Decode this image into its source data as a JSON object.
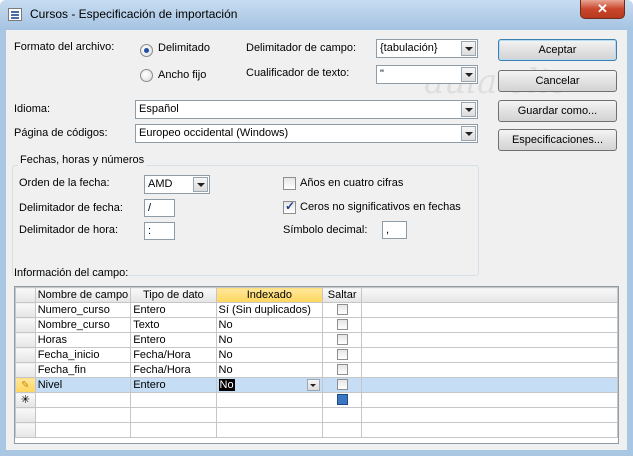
{
  "window": {
    "title": "Cursos - Especificación de importación",
    "close_glyph": "✕"
  },
  "format": {
    "label": "Formato del archivo:",
    "options": [
      {
        "label": "Delimitado",
        "selected": true
      },
      {
        "label": "Ancho fijo",
        "selected": false
      }
    ]
  },
  "delimiter": {
    "label": "Delimitador de campo:",
    "value": "{tabulación}"
  },
  "qualifier": {
    "label": "Cualificador de texto:",
    "value": "\""
  },
  "language": {
    "label": "Idioma:",
    "value": "Español"
  },
  "codepage": {
    "label": "Página de códigos:",
    "value": "Europeo occidental (Windows)"
  },
  "group": {
    "title": "Fechas, horas y números",
    "date_order": {
      "label": "Orden de la fecha:",
      "value": "AMD"
    },
    "date_delimiter": {
      "label": "Delimitador de fecha:",
      "value": "/"
    },
    "time_delimiter": {
      "label": "Delimitador de hora:",
      "value": ":"
    },
    "four_digit_years": {
      "label": "Años en cuatro cifras",
      "checked": false
    },
    "leading_zeros": {
      "label": "Ceros no significativos en fechas",
      "checked": true
    },
    "decimal_symbol": {
      "label": "Símbolo decimal:",
      "value": ","
    }
  },
  "buttons": {
    "accept": "Aceptar",
    "cancel": "Cancelar",
    "save_as": "Guardar como...",
    "specs": "Especificaciones..."
  },
  "field_info_label": "Información del campo:",
  "grid": {
    "columns": [
      "Nombre de campo",
      "Tipo de dato",
      "Indexado",
      "Saltar"
    ],
    "rows": [
      {
        "name": "Numero_curso",
        "type": "Entero",
        "indexed": "Sí (Sin duplicados)",
        "skip": false
      },
      {
        "name": "Nombre_curso",
        "type": "Texto",
        "indexed": "No",
        "skip": false
      },
      {
        "name": "Horas",
        "type": "Entero",
        "indexed": "No",
        "skip": false
      },
      {
        "name": "Fecha_inicio",
        "type": "Fecha/Hora",
        "indexed": "No",
        "skip": false
      },
      {
        "name": "Fecha_fin",
        "type": "Fecha/Hora",
        "indexed": "No",
        "skip": false
      },
      {
        "name": "Nivel",
        "type": "Entero",
        "indexed": "No",
        "skip": false
      }
    ],
    "new_row_marker": "✳",
    "edit_marker": "✎"
  },
  "watermark": "aula clic",
  "colors": {
    "selected_header": "#ffd65c",
    "active_row": "#c5def5",
    "frame": "#a9c7e3"
  }
}
